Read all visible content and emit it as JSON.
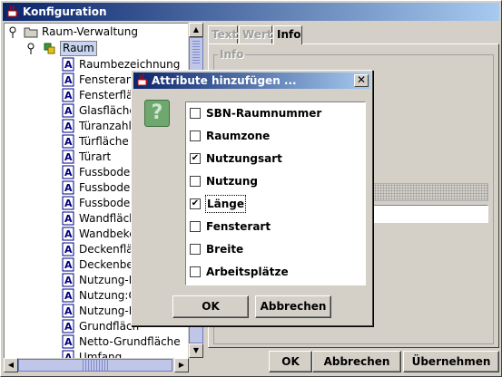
{
  "window": {
    "title": "Konfiguration"
  },
  "tree": {
    "root_label": "Raum-Verwaltung",
    "selected_label": "Raum",
    "leaves": [
      "Raumbezeichnung",
      "Fensteran",
      "Fensterflä",
      "Glasfläche",
      "Türanzahl",
      "Türfläche",
      "Türart",
      "Fussbode",
      "Fussbode",
      "Fussbode",
      "Wandfläch",
      "Wandbeke",
      "Deckenflä",
      "Deckenbe",
      "Nutzung-K",
      "Nutzung:O",
      "Nutzung-M",
      "Grundfläch",
      "Netto-Grundfläche",
      "Umfang"
    ]
  },
  "tabs": [
    {
      "label": "Text",
      "enabled": false
    },
    {
      "label": "Wert",
      "enabled": false
    },
    {
      "label": "Info",
      "enabled": true,
      "active": true
    }
  ],
  "info_group": {
    "title": "Info"
  },
  "bottom_buttons": {
    "ok": "OK",
    "cancel": "Abbrechen",
    "apply": "Übernehmen"
  },
  "dialog": {
    "title": "Attribute hinzufügen ...",
    "icon": "question-icon",
    "options": [
      {
        "label": "SBN-Raumnummer",
        "checked": false
      },
      {
        "label": "Raumzone",
        "checked": false
      },
      {
        "label": "Nutzungsart",
        "checked": true
      },
      {
        "label": "Nutzung",
        "checked": false
      },
      {
        "label": "Länge",
        "checked": true,
        "focused": true
      },
      {
        "label": "Fensterart",
        "checked": false
      },
      {
        "label": "Breite",
        "checked": false
      },
      {
        "label": "Arbeitsplätze",
        "checked": false
      }
    ],
    "ok_label": "OK",
    "cancel_label": "Abbrechen"
  },
  "colors": {
    "titlebar_start": "#0a246a",
    "titlebar_end": "#a6caf0",
    "face": "#d4d0c8"
  }
}
